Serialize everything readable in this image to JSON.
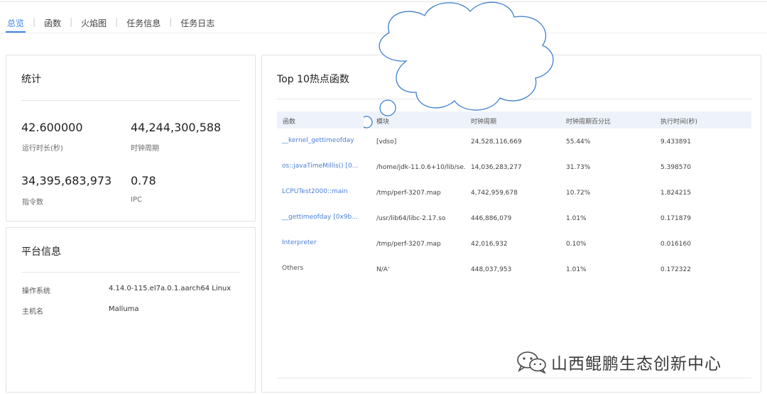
{
  "tabs": [
    {
      "label": "总览",
      "active": true
    },
    {
      "label": "函数",
      "active": false
    },
    {
      "label": "火焰图",
      "active": false
    },
    {
      "label": "任务信息",
      "active": false
    },
    {
      "label": "任务日志",
      "active": false
    }
  ],
  "stats": {
    "title": "统计",
    "items": [
      {
        "value": "42.600000",
        "label": "运行时长(秒)"
      },
      {
        "value": "44,244,300,588",
        "label": "时钟周期"
      },
      {
        "value": "34,395,683,973",
        "label": "指令数"
      },
      {
        "value": "0.78",
        "label": "IPC"
      }
    ]
  },
  "platform": {
    "title": "平台信息",
    "rows": [
      {
        "key": "操作系统",
        "value": "4.14.0-115.el7a.0.1.aarch64 Linux"
      },
      {
        "key": "主机名",
        "value": "Malluma"
      }
    ]
  },
  "hot_functions": {
    "title": "Top 10热点函数",
    "columns": [
      "函数",
      "模块",
      "时钟周期",
      "时钟周期百分比",
      "执行时间(秒)"
    ],
    "rows": [
      {
        "func": "__kernel_gettimeofday",
        "module": "[vdso]",
        "cycles": "24,528,116,669",
        "pct": "55.44%",
        "time": "9.433891",
        "link": true
      },
      {
        "func": "os::javaTimeMillis() [0...",
        "module": "/home/jdk-11.0.6+10/lib/se...",
        "cycles": "14,036,283,277",
        "pct": "31.73%",
        "time": "5.398570",
        "link": true
      },
      {
        "func": "LCPUTest2000::main",
        "module": "/tmp/perf-3207.map",
        "cycles": "4,742,959,678",
        "pct": "10.72%",
        "time": "1.824215",
        "link": true
      },
      {
        "func": "__gettimeofday [0x9b...",
        "module": "/usr/lib64/libc-2.17.so",
        "cycles": "446,886,079",
        "pct": "1.01%",
        "time": "0.171879",
        "link": true
      },
      {
        "func": "Interpreter",
        "module": "/tmp/perf-3207.map",
        "cycles": "42,016,932",
        "pct": "0.10%",
        "time": "0.016160",
        "link": true
      },
      {
        "func": "Others",
        "module": "N/A'",
        "cycles": "448,037,953",
        "pct": "1.01%",
        "time": "0.172322",
        "link": false
      }
    ]
  },
  "watermark": {
    "text": "山西鲲鹏生态创新中心",
    "icon": "wechat-icon"
  },
  "colors": {
    "accent": "#3c82e6",
    "link": "#4a7fd6",
    "table_header": "#eef3fb"
  }
}
